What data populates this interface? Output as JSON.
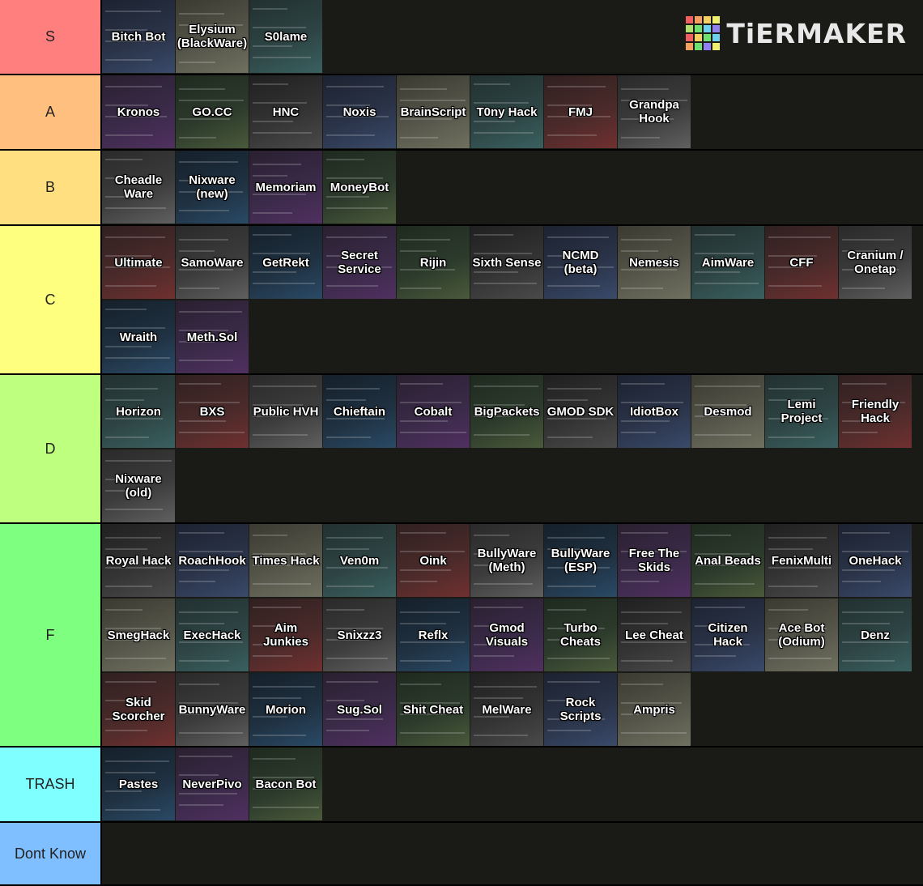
{
  "logo": {
    "text": "TiERMAKER",
    "squares": [
      "#f06060",
      "#f5a060",
      "#f5d060",
      "#f0f070",
      "#b0e070",
      "#70e070",
      "#70d0f0",
      "#9080f0",
      "#f06060",
      "#f5d060",
      "#70e070",
      "#70d0f0",
      "#f5a060",
      "#70e070",
      "#9080f0",
      "#f0f070"
    ]
  },
  "tiers": [
    {
      "label": "S",
      "color": "#ff7f7f",
      "items": [
        "Bitch Bot",
        "Elysium (BlackWare)",
        "S0lame"
      ]
    },
    {
      "label": "A",
      "color": "#ffbf7f",
      "items": [
        "Kronos",
        "GO.CC",
        "HNC",
        "Noxis",
        "BrainScript",
        "T0ny Hack",
        "FMJ",
        "Grandpa Hook"
      ]
    },
    {
      "label": "B",
      "color": "#ffdf7f",
      "items": [
        "Cheadle Ware",
        "Nixware (new)",
        "Memoriam",
        "MoneyBot"
      ]
    },
    {
      "label": "C",
      "color": "#ffff7f",
      "items": [
        "Ultimate",
        "SamoWare",
        "GetRekt",
        "Secret Service",
        "Rijin",
        "Sixth Sense",
        "NCMD (beta)",
        "Nemesis",
        "AimWare",
        "CFF",
        "Cranium / Onetap",
        "Wraith",
        "Meth.Sol"
      ]
    },
    {
      "label": "D",
      "color": "#bfff7f",
      "items": [
        "Horizon",
        "BXS",
        "Public HVH",
        "Chieftain",
        "Cobalt",
        "BigPackets",
        "GMOD SDK",
        "IdiotBox",
        "Desmod",
        "Lemi Project",
        "Friendly Hack",
        "Nixware (old)"
      ]
    },
    {
      "label": "F",
      "color": "#7fff7f",
      "items": [
        "Royal Hack",
        "RoachHook",
        "Times Hack",
        "Ven0m",
        "Oink",
        "BullyWare (Meth)",
        "BullyWare (ESP)",
        "Free The Skids",
        "Anal Beads",
        "FenixMulti",
        "OneHack",
        "SmegHack",
        "ExecHack",
        "Aim Junkies",
        "Snixzz3",
        "Reflx",
        "Gmod Visuals",
        "Turbo Cheats",
        "Lee Cheat",
        "Citizen Hack",
        "Ace Bot (Odium)",
        "Denz",
        "Skid Scorcher",
        "BunnyWare",
        "Morion",
        "Sug.Sol",
        "Shit Cheat",
        "MelWare",
        "Rock Scripts",
        "Ampris"
      ]
    },
    {
      "label": "TRASH",
      "color": "#7fffff",
      "items": [
        "Pastes",
        "NeverPivo",
        "Bacon Bot"
      ]
    },
    {
      "label": "Dont Know",
      "color": "#7fbfff",
      "items": []
    }
  ]
}
